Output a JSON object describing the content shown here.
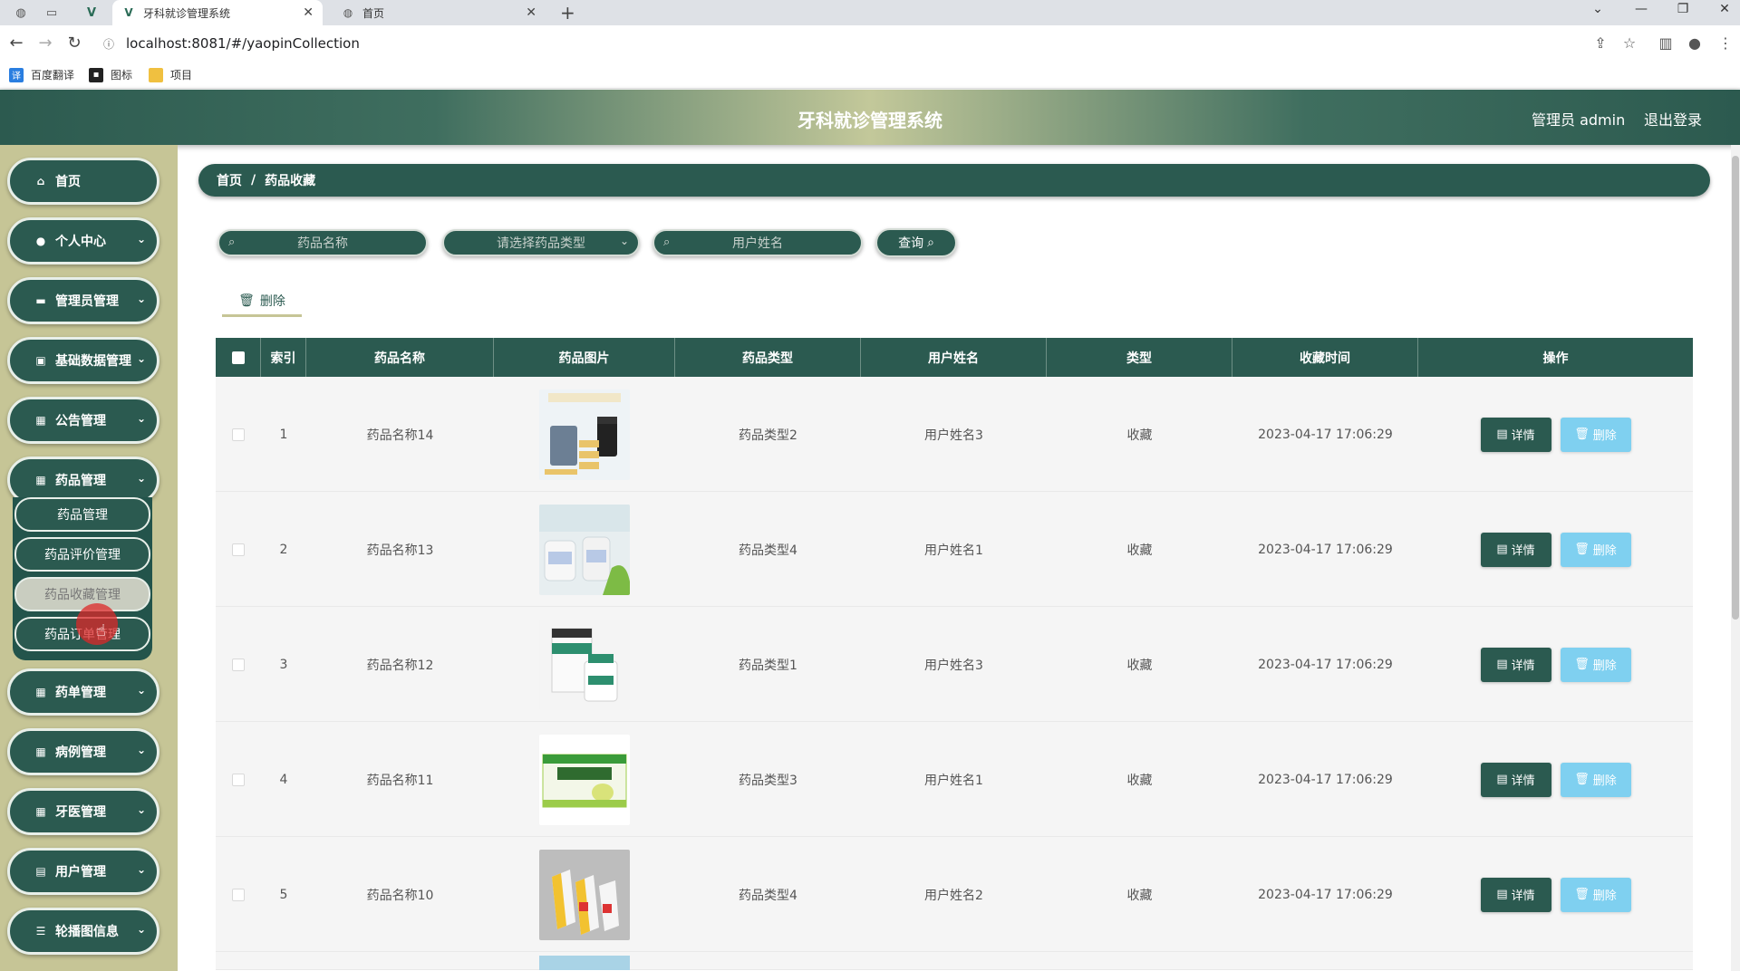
{
  "browser": {
    "tabs": [
      {
        "title": "牙科就诊管理系统",
        "close": "✕"
      },
      {
        "title": "首页",
        "close": "✕"
      }
    ],
    "new_tab": "+",
    "url": "localhost:8081/#/yaopinCollection",
    "bookmarks": [
      "百度翻译",
      "图标",
      "项目"
    ]
  },
  "header": {
    "title": "牙科就诊管理系统",
    "admin": "管理员 admin",
    "logout": "退出登录"
  },
  "sidebar": {
    "items": [
      {
        "label": "首页",
        "icon": "home-icon",
        "has_arrow": false
      },
      {
        "label": "个人中心",
        "icon": "user-icon",
        "has_arrow": true
      },
      {
        "label": "管理员管理",
        "icon": "monitor-icon",
        "has_arrow": true
      },
      {
        "label": "基础数据管理",
        "icon": "chart-icon",
        "has_arrow": true
      },
      {
        "label": "公告管理",
        "icon": "grid-icon",
        "has_arrow": true
      },
      {
        "label": "药品管理",
        "icon": "grid-icon",
        "has_arrow": true
      },
      {
        "label": "药单管理",
        "icon": "grid-icon",
        "has_arrow": true
      },
      {
        "label": "病例管理",
        "icon": "grid-icon",
        "has_arrow": true
      },
      {
        "label": "牙医管理",
        "icon": "grid-icon",
        "has_arrow": true
      },
      {
        "label": "用户管理",
        "icon": "clipboard-icon",
        "has_arrow": true
      },
      {
        "label": "轮播图信息",
        "icon": "list-icon",
        "has_arrow": true
      }
    ],
    "subitems": [
      "药品管理",
      "药品评价管理",
      "药品收藏管理",
      "药品订单管理"
    ],
    "active_subitem": 2
  },
  "breadcrumb": {
    "home": "首页",
    "current": "药品收藏"
  },
  "search": {
    "name_placeholder": "药品名称",
    "type_placeholder": "请选择药品类型",
    "user_placeholder": "用户姓名",
    "query_label": "查询"
  },
  "toolbar": {
    "delete_label": "删除"
  },
  "table": {
    "columns": [
      "索引",
      "药品名称",
      "药品图片",
      "药品类型",
      "用户姓名",
      "类型",
      "收藏时间",
      "操作"
    ],
    "detail_label": "详情",
    "delete_label": "删除",
    "rows": [
      {
        "index": "1",
        "name": "药品名称14",
        "type": "药品类型2",
        "user": "用户姓名3",
        "kind": "收藏",
        "time": "2023-04-17 17:06:29"
      },
      {
        "index": "2",
        "name": "药品名称13",
        "type": "药品类型4",
        "user": "用户姓名1",
        "kind": "收藏",
        "time": "2023-04-17 17:06:29"
      },
      {
        "index": "3",
        "name": "药品名称12",
        "type": "药品类型1",
        "user": "用户姓名3",
        "kind": "收藏",
        "time": "2023-04-17 17:06:29"
      },
      {
        "index": "4",
        "name": "药品名称11",
        "type": "药品类型3",
        "user": "用户姓名1",
        "kind": "收藏",
        "time": "2023-04-17 17:06:29"
      },
      {
        "index": "5",
        "name": "药品名称10",
        "type": "药品类型4",
        "user": "用户姓名2",
        "kind": "收藏",
        "time": "2023-04-17 17:06:29"
      }
    ]
  },
  "colors": {
    "primary": "#2b5a50",
    "sidebar_bg": "#c6c596",
    "delete_btn": "#7fd0f0"
  }
}
